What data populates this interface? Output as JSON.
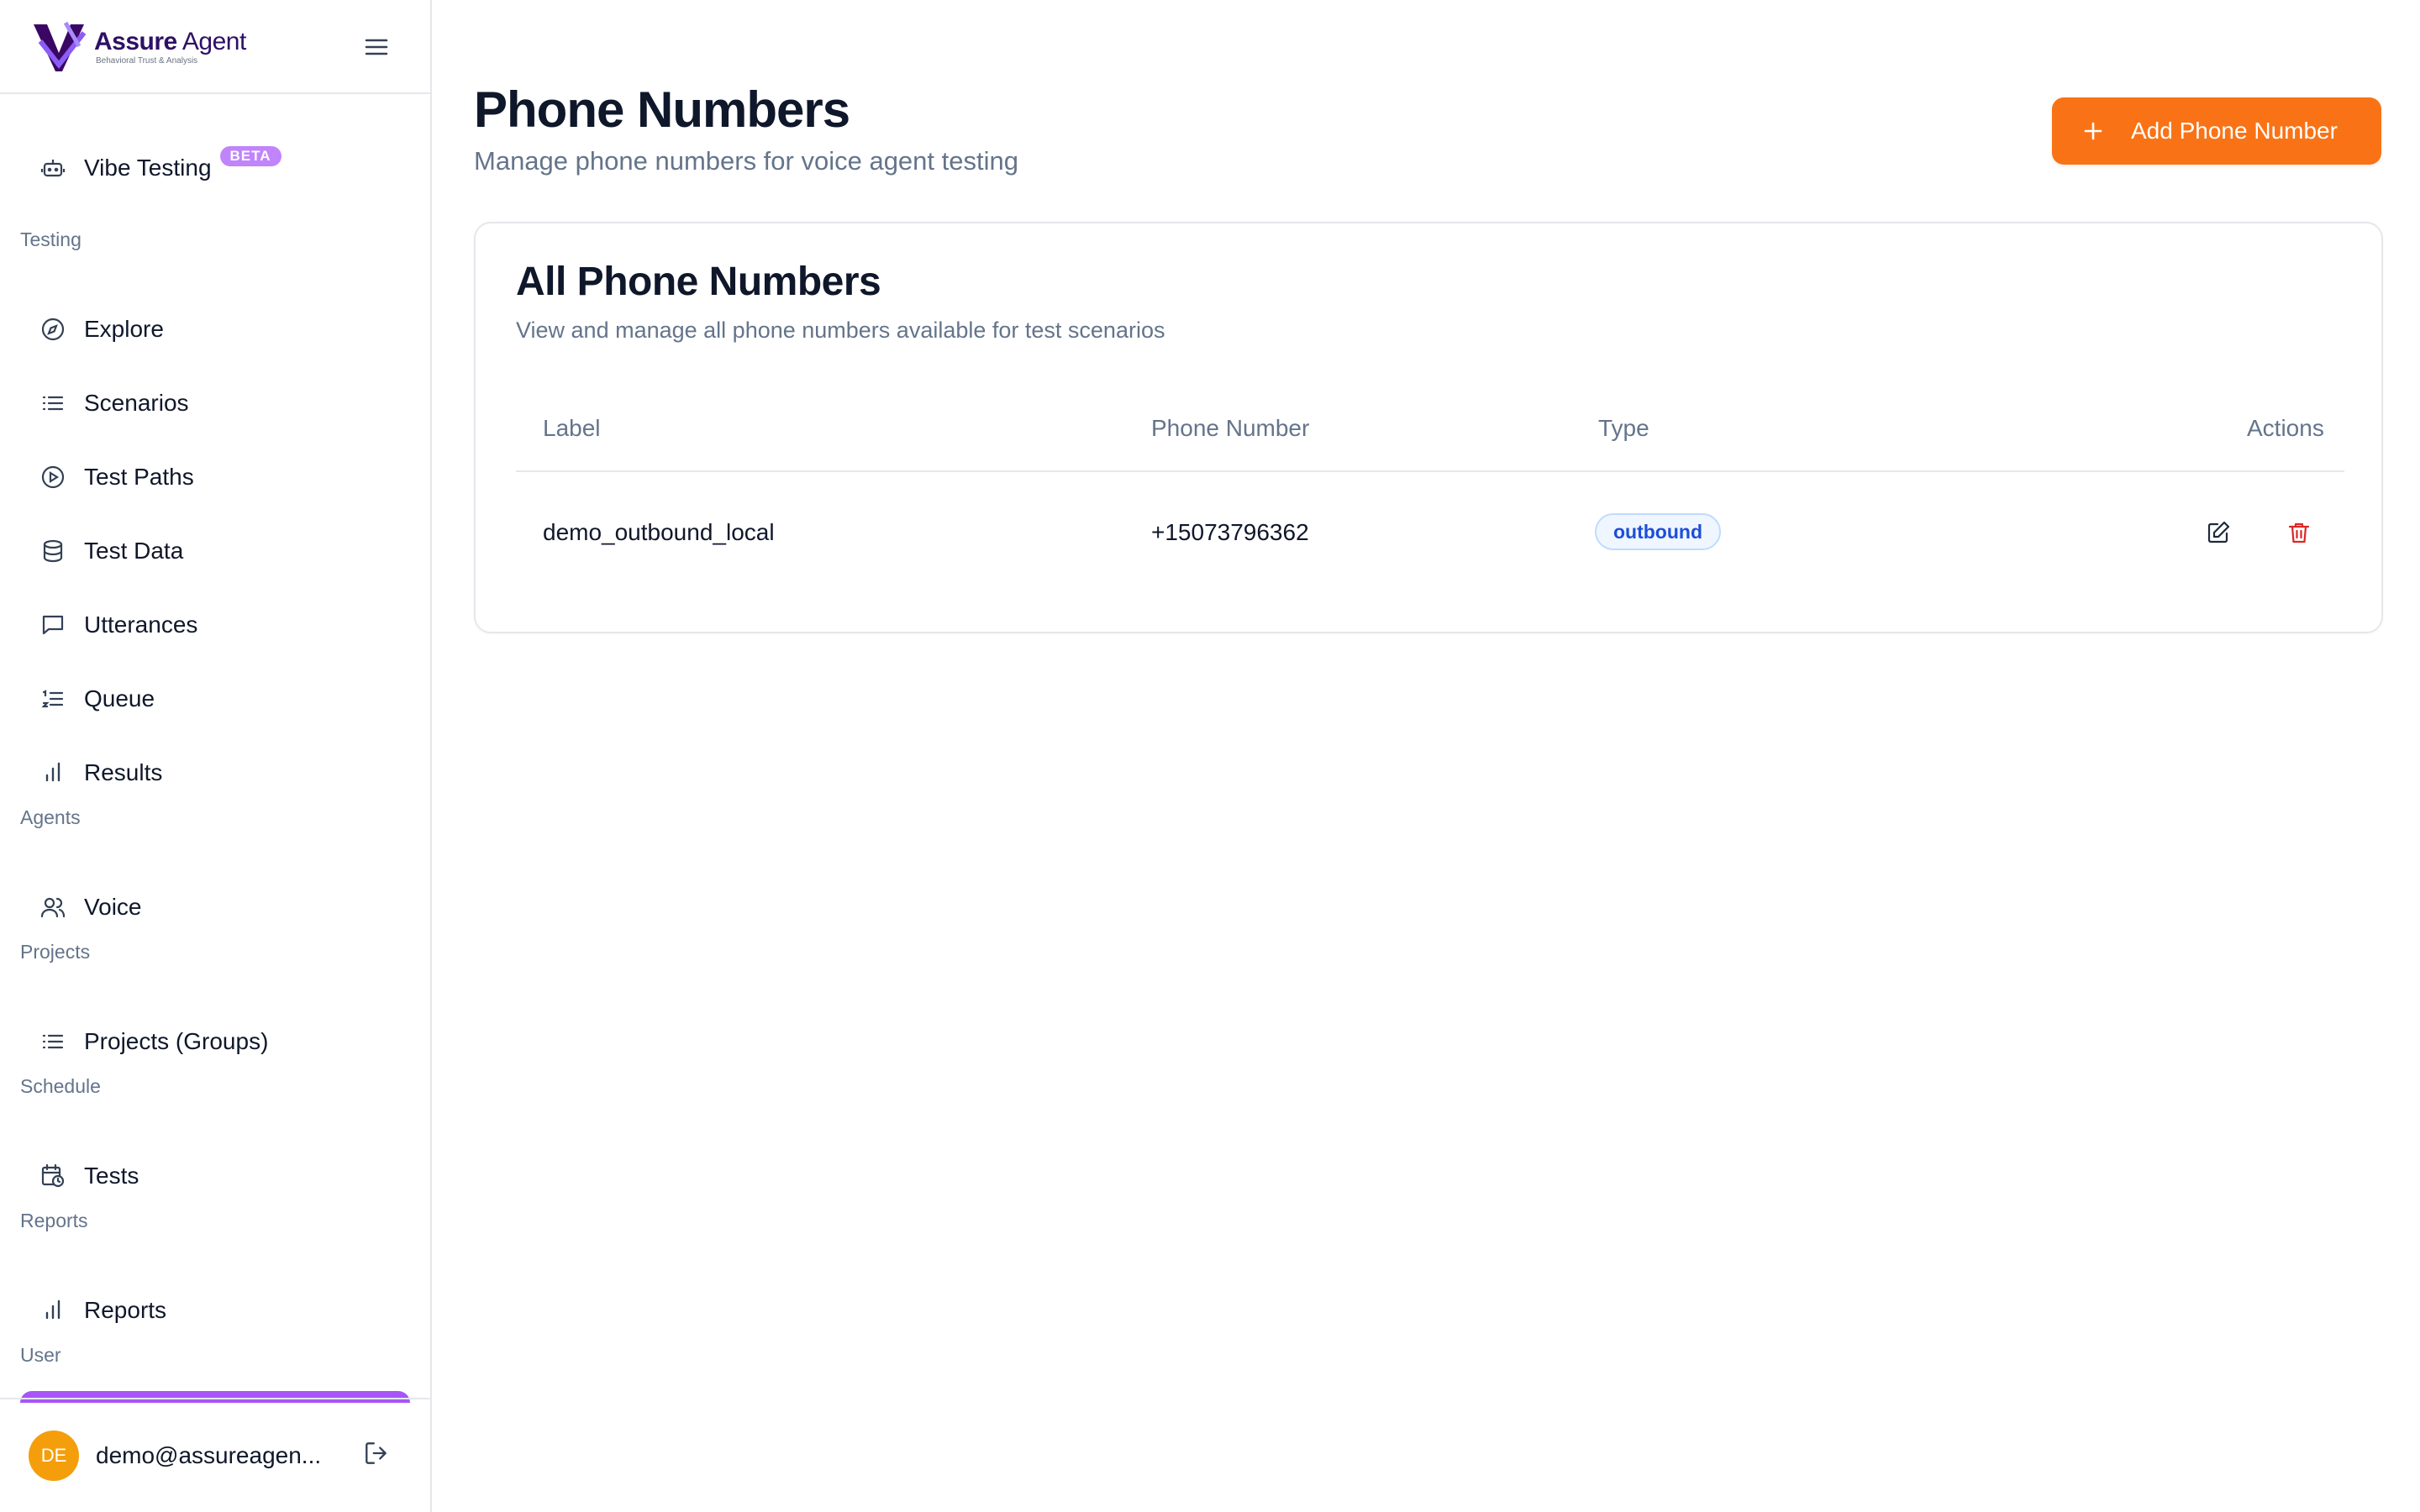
{
  "brand": {
    "name_bold": "Assure",
    "name_light": " Agent",
    "tagline": "Behavioral Trust & Analysis",
    "colors": {
      "primary": "#7c3aed",
      "dark": "#2e1065"
    }
  },
  "sidebar": {
    "menu_icon": "hamburger-icon",
    "vibe": {
      "label": "Vibe Testing",
      "badge": "BETA",
      "icon": "robot-icon"
    },
    "sections": [
      {
        "label": "Testing",
        "items": [
          {
            "label": "Explore",
            "icon": "compass-icon"
          },
          {
            "label": "Scenarios",
            "icon": "list-icon"
          },
          {
            "label": "Test Paths",
            "icon": "play-circle-icon"
          },
          {
            "label": "Test Data",
            "icon": "database-icon"
          },
          {
            "label": "Utterances",
            "icon": "message-square-icon"
          },
          {
            "label": "Queue",
            "icon": "list-ordered-icon"
          },
          {
            "label": "Results",
            "icon": "bar-chart-icon"
          }
        ]
      },
      {
        "label": "Agents",
        "items": [
          {
            "label": "Voice",
            "icon": "users-icon"
          }
        ]
      },
      {
        "label": "Projects",
        "items": [
          {
            "label": "Projects (Groups)",
            "icon": "list-icon"
          }
        ]
      },
      {
        "label": "Schedule",
        "items": [
          {
            "label": "Tests",
            "icon": "calendar-clock-icon"
          }
        ]
      },
      {
        "label": "Reports",
        "items": [
          {
            "label": "Reports",
            "icon": "bar-chart-icon"
          }
        ]
      },
      {
        "label": "User",
        "items": []
      }
    ],
    "active_color": "#a855f7",
    "user": {
      "initials": "DE",
      "email": "demo@assureagen...",
      "logout_icon": "log-out-icon"
    }
  },
  "main": {
    "title": "Phone Numbers",
    "subtitle": "Manage phone numbers for voice agent testing",
    "add_button": {
      "label": "Add Phone Number",
      "icon": "plus-icon",
      "color": "#f97316"
    },
    "card": {
      "title": "All Phone Numbers",
      "subtitle": "View and manage all phone numbers available for test scenarios",
      "columns": [
        "Label",
        "Phone Number",
        "Type",
        "Actions"
      ],
      "rows": [
        {
          "label": "demo_outbound_local",
          "phone": "+15073796362",
          "type": "outbound",
          "actions": [
            "edit-icon",
            "trash-icon"
          ]
        }
      ]
    }
  }
}
